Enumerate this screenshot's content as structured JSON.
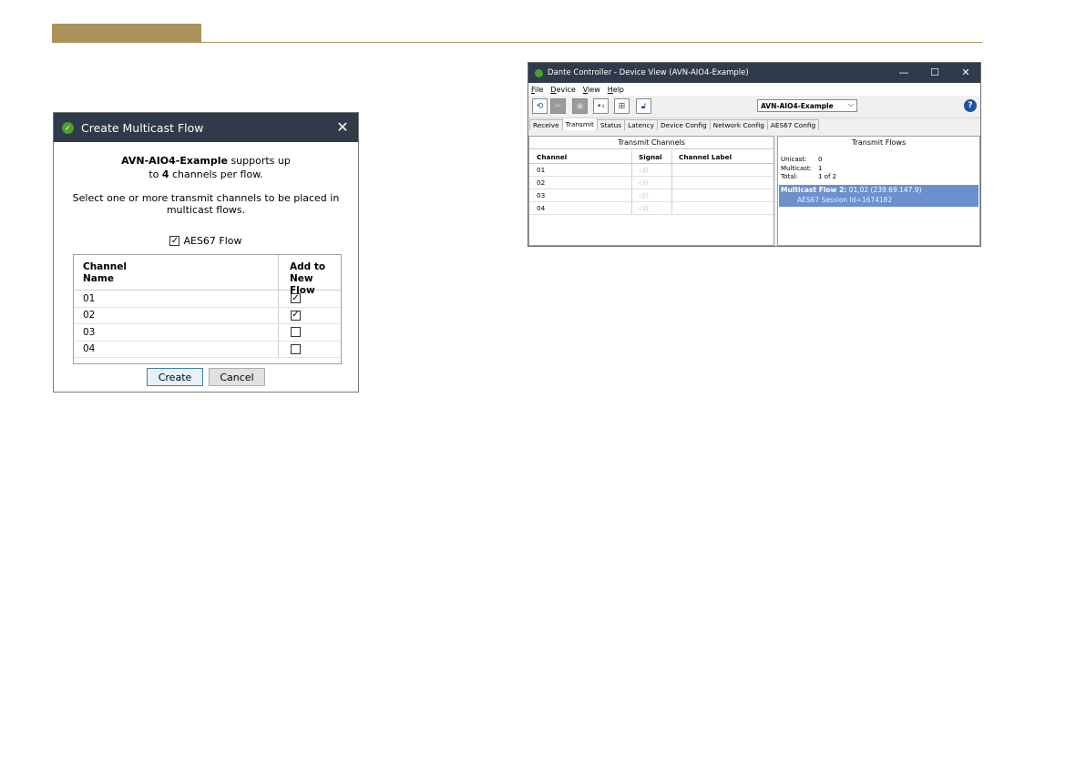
{
  "dialog": {
    "title": "Create Multicast Flow",
    "close_glyph": "✕",
    "device_name": "AVN-AIO4-Example",
    "msg_part1": " supports up",
    "msg_part2_prefix": "to ",
    "channel_count": "4",
    "msg_part2_suffix": " channels per flow.",
    "instruction": "Select one or more transmit channels to be placed in multicast flows.",
    "aes67_label": "AES67 Flow",
    "aes67_checked": true,
    "col_channel_l1": "Channel",
    "col_channel_l2": "Name",
    "col_add_l1": "Add to",
    "col_add_l2": "New Flow",
    "rows": [
      {
        "name": "01",
        "checked": true
      },
      {
        "name": "02",
        "checked": true
      },
      {
        "name": "03",
        "checked": false
      },
      {
        "name": "04",
        "checked": false
      }
    ],
    "create_label": "Create",
    "cancel_label": "Cancel"
  },
  "dante": {
    "title": "Dante Controller - Device View (AVN-AIO4-Example)",
    "window_controls": {
      "minimize": "—",
      "maximize": "☐",
      "close": "✕"
    },
    "menu": [
      "File",
      "Device",
      "View",
      "Help"
    ],
    "device_selector": "AVN-AIO4-Example",
    "dropdown_glyph": "⌵",
    "help_glyph": "?",
    "toolbar_icons": [
      "refresh-icon",
      "tools-icon",
      "eye-icon",
      "network-icon",
      "grid-icon",
      "lock-icon"
    ],
    "tabs": [
      "Receive",
      "Transmit",
      "Status",
      "Latency",
      "Device Config",
      "Network Config",
      "AES67 Config"
    ],
    "active_tab": "Transmit",
    "left_panel": {
      "title": "Transmit Channels",
      "headers": [
        "Channel",
        "Signal",
        "Channel Label"
      ],
      "rows": [
        "01",
        "02",
        "03",
        "04"
      ]
    },
    "right_panel": {
      "title": "Transmit Flows",
      "unicast_label": "Unicast:",
      "unicast_value": "0",
      "multicast_label": "Multicast:",
      "multicast_value": "1",
      "total_label": "Total:",
      "total_value": "1 of 2",
      "flow_name": "Multicast Flow 2:",
      "flow_detail": " 01,02 (239.69.147.9)",
      "flow_session": "AES67 Session Id=1674182"
    }
  },
  "colors": {
    "header_accent": "#ab9259",
    "titlebar": "#2f3a4a",
    "selection": "#6c8fce"
  }
}
